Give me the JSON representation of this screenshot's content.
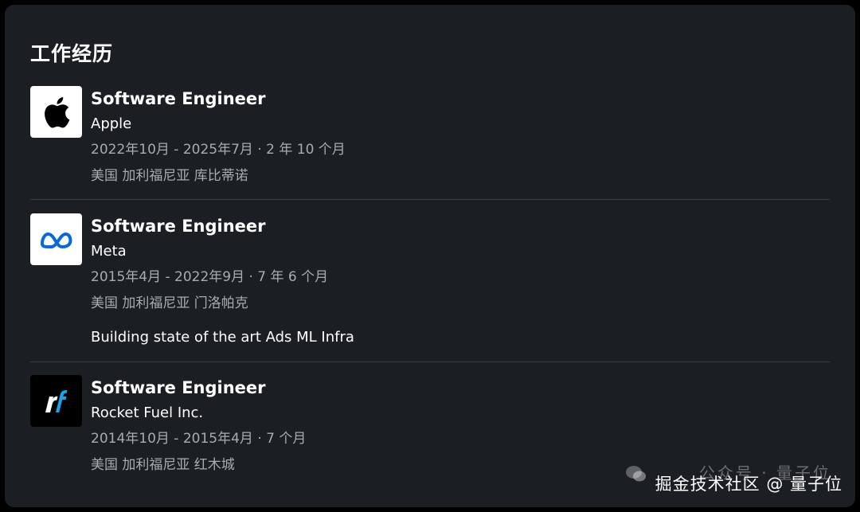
{
  "section": {
    "title": "工作经历"
  },
  "experiences": [
    {
      "role": "Software Engineer",
      "company": "Apple",
      "dates": "2022年10月 - 2025年7月 · 2 年 10 个月",
      "location": "美国 加利福尼亚 库比蒂诺",
      "logo": "apple-logo"
    },
    {
      "role": "Software Engineer",
      "company": "Meta",
      "dates": "2015年4月 - 2022年9月 · 7 年 6 个月",
      "location": "美国 加利福尼亚 门洛帕克",
      "description": "Building state of the art Ads ML Infra",
      "logo": "meta-logo"
    },
    {
      "role": "Software Engineer",
      "company": "Rocket Fuel Inc.",
      "dates": "2014年10月 - 2015年4月 · 7 个月",
      "location": "美国 加利福尼亚 红木城",
      "logo": "rocket-fuel-logo"
    }
  ],
  "watermark": {
    "account": "公众号 · 量子位",
    "source": "掘金技术社区 @ 量子位"
  },
  "colors": {
    "background": "#1b1f23",
    "divider": "#3a3f44",
    "meta_text": "#a8acb0",
    "meta_blue": "#0668e1",
    "rocket_blue": "#1aa3e8"
  }
}
